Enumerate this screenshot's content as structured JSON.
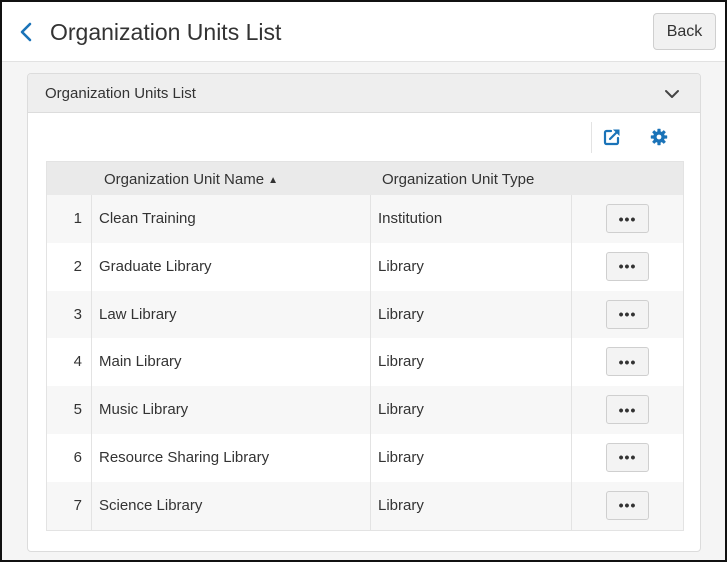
{
  "header": {
    "title": "Organization Units List",
    "back_label": "Back",
    "back_icon": "chevron-left-icon"
  },
  "panel": {
    "title": "Organization Units List",
    "collapse_icon": "chevron-down-icon",
    "toolbar": {
      "export_icon": "export-icon",
      "settings_icon": "gear-icon"
    }
  },
  "table": {
    "columns": {
      "name": "Organization Unit Name",
      "type": "Organization Unit Type"
    },
    "sort_indicator": "▲",
    "rows": [
      {
        "num": "1",
        "name": "Clean Training",
        "type": "Institution",
        "action": "•••"
      },
      {
        "num": "2",
        "name": "Graduate Library",
        "type": "Library",
        "action": "•••"
      },
      {
        "num": "3",
        "name": "Law Library",
        "type": "Library",
        "action": "•••"
      },
      {
        "num": "4",
        "name": "Main Library",
        "type": "Library",
        "action": "•••"
      },
      {
        "num": "5",
        "name": "Music Library",
        "type": "Library",
        "action": "•••"
      },
      {
        "num": "6",
        "name": "Resource Sharing Library",
        "type": "Library",
        "action": "•••"
      },
      {
        "num": "7",
        "name": "Science Library",
        "type": "Library",
        "action": "•••"
      }
    ]
  },
  "colors": {
    "accent": "#1a73b8",
    "header_bg": "#ffffff",
    "page_bg": "#f5f5f5",
    "table_header_bg": "#eaeaea"
  }
}
